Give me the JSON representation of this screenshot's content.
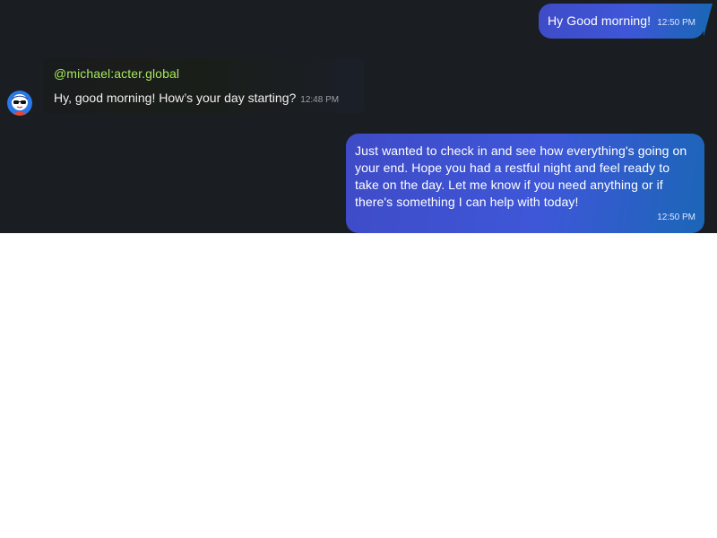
{
  "messages": {
    "outgoing_1": {
      "text": "Hy Good morning!",
      "time": "12:50 PM"
    },
    "incoming_1": {
      "sender": "@michael:acter.global",
      "text": "Hy, good morning! How’s your day starting?",
      "time": "12:48 PM",
      "avatar_icon": "avatar-sunglasses-icon"
    },
    "outgoing_2": {
      "text": "Just wanted to check in and see how everything's going on your end. Hope you had a restful night and feel ready to take on the day. Let me know if you need anything or if there's something I can help with today!",
      "time": "12:50 PM"
    }
  },
  "theme": {
    "chat_background": "#1a1d21",
    "bubble_gradient_start": "#3f4bc7",
    "bubble_gradient_end": "#1b66b7",
    "sender_color": "#a5e75d"
  }
}
